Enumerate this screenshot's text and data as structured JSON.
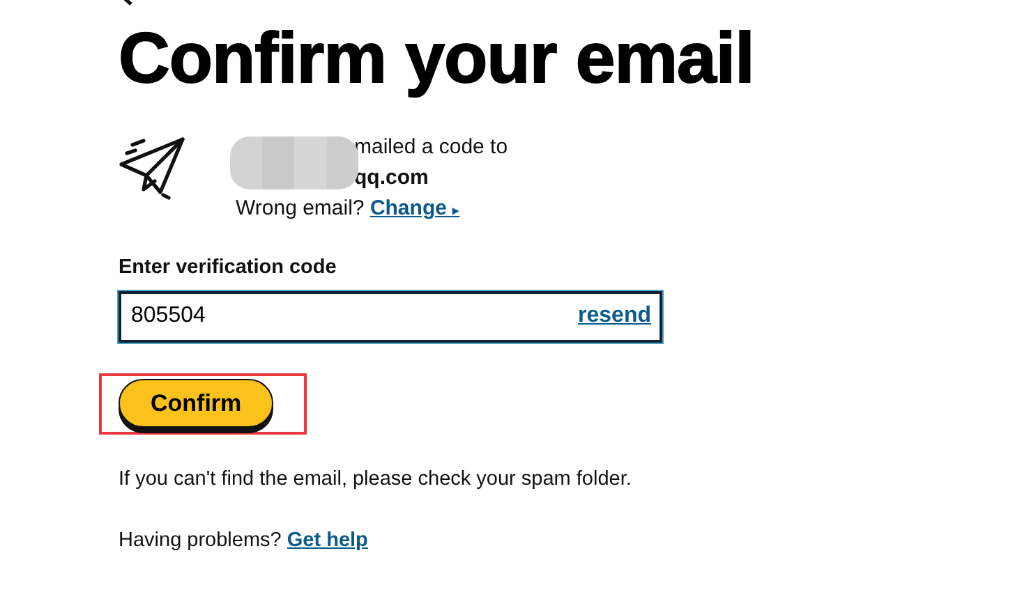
{
  "heading": "Confirm your email",
  "sent_notice": {
    "line_1": "mailed a code to",
    "email_fragment": "qq.com",
    "wrong_email_prompt": "Wrong email?",
    "change_link": "Change",
    "change_arrow": "▸",
    "redacted": true
  },
  "code_field": {
    "label": "Enter verification code",
    "value": "805504",
    "resend_link": "resend"
  },
  "confirm_button": {
    "label": "Confirm",
    "highlighted": true
  },
  "spam_note": "If you can't find the email, please check your spam folder.",
  "help": {
    "prompt": "Having problems?",
    "link": "Get help"
  }
}
